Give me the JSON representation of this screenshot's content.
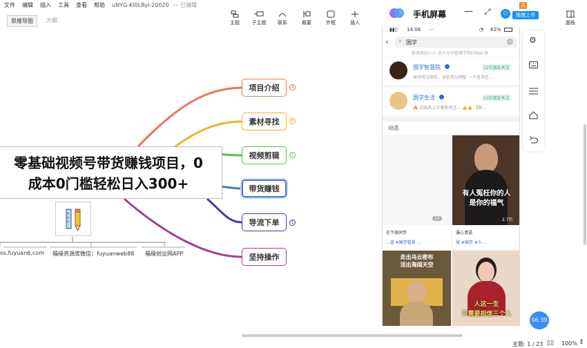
{
  "menu": {
    "items": [
      "文件",
      "编辑",
      "插入",
      "工具",
      "查看",
      "帮助"
    ],
    "doc_title": "uNYG-KI0LRyl-20020",
    "save_status": "— 已编辑"
  },
  "tabs": {
    "active": "思维导图",
    "inactive": "大纲"
  },
  "toolbar": {
    "topic": "主题",
    "subtopic": "子主题",
    "relation": "联系",
    "summary": "概要",
    "boundary": "外框",
    "insert": "插入",
    "panel": "面板"
  },
  "mindmap": {
    "central_line1": "零基础视频号带货赚钱项目，0",
    "central_line2": "成本0门槛轻松日入300+",
    "branches": [
      {
        "label": "项目介绍",
        "badge": "4",
        "color": "#e8735f"
      },
      {
        "label": "素材寻找",
        "badge": "8",
        "color": "#f0b429"
      },
      {
        "label": "视频剪辑",
        "badge": "1",
        "color": "#5cb85c"
      },
      {
        "label": "带货赚钱",
        "badge": "",
        "color": "#4a78c2"
      },
      {
        "label": "导流下单",
        "badge": "1",
        "color": "#3b3fa8"
      },
      {
        "label": "坚持操作",
        "badge": "",
        "color": "#a0418e"
      }
    ],
    "footer_labels": [
      "os.fuyuan6.com",
      "福缘资源库微信：fuyuanweb88",
      "福缘创业网APP"
    ]
  },
  "status": {
    "topic_count": "主题: 1 / 23",
    "zoom": "100%"
  },
  "phone_window": {
    "title": "手机屏幕",
    "upload_label": "拖拽上传",
    "tag": "天",
    "status_time": "14:08",
    "status_battery": "62%",
    "search_text": "国学",
    "prev_snippet": "新浪原创人人 北大光华管理学院EMBA 研",
    "accounts": [
      {
        "name": "国学智慧院",
        "follow": "12位朋友关注",
        "desc": "读书可以明志，读史可以明智 一个连书艺..."
      },
      {
        "name": "国学生活",
        "follow": "10位朋友关注",
        "desc": "🔥 点击名上方黄色关注... 👍👍 【国..."
      }
    ],
    "feed_label": "动态",
    "posts": [
      {
        "author": "在下周同学",
        "tags": "...道 #国学智慧 ...",
        "likes": "23"
      },
      {
        "author": "瀛心清语",
        "tags": "慧 #国学 #人 ...",
        "likes": "2.7万",
        "caption1": "有人冤枉你的人",
        "caption2": "是你的福气"
      },
      {
        "caption1": "走出乌云密布",
        "caption2": "活出海阔天空"
      },
      {
        "caption1": "人这一生",
        "caption2": "只需要相信三个人"
      }
    ],
    "timer": "06:39"
  }
}
